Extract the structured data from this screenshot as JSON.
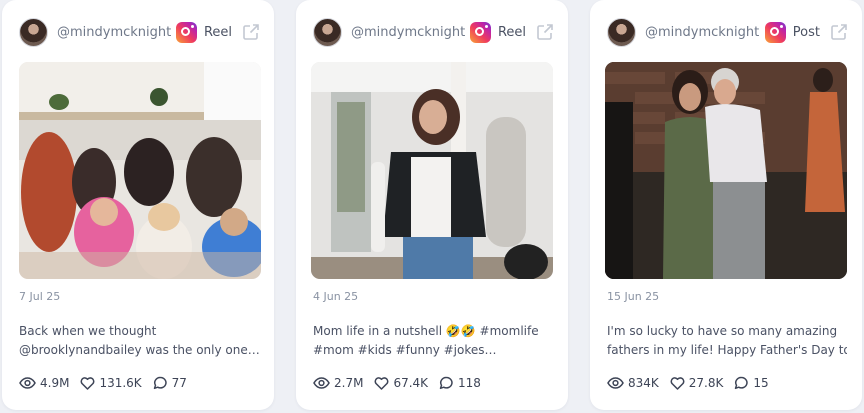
{
  "cards": [
    {
      "handle": "@mindymcknight",
      "platform_icon": "instagram-icon",
      "type": "Reel",
      "date": "7 Jul 25",
      "caption_line1": "Back when we thought",
      "caption_line2": "@brooklynandbailey was the only one…",
      "views": "4.9M",
      "likes": "131.6K",
      "comments": "77"
    },
    {
      "handle": "@mindymcknight",
      "platform_icon": "instagram-icon",
      "type": "Reel",
      "date": "4 Jun 25",
      "caption_line1": "Mom life in a nutshell 🤣🤣 #momlife",
      "caption_line2": "#mom #kids #funny #jokes…",
      "views": "2.7M",
      "likes": "67.4K",
      "comments": "118"
    },
    {
      "handle": "@mindymcknight",
      "platform_icon": "instagram-icon",
      "type": "Post",
      "date": "15 Jun 25",
      "caption_line1": "I'm so lucky to have so many amazing",
      "caption_line2": "fathers in my life! Happy Father's Day to…",
      "views": "834K",
      "likes": "27.8K",
      "comments": "15"
    }
  ]
}
